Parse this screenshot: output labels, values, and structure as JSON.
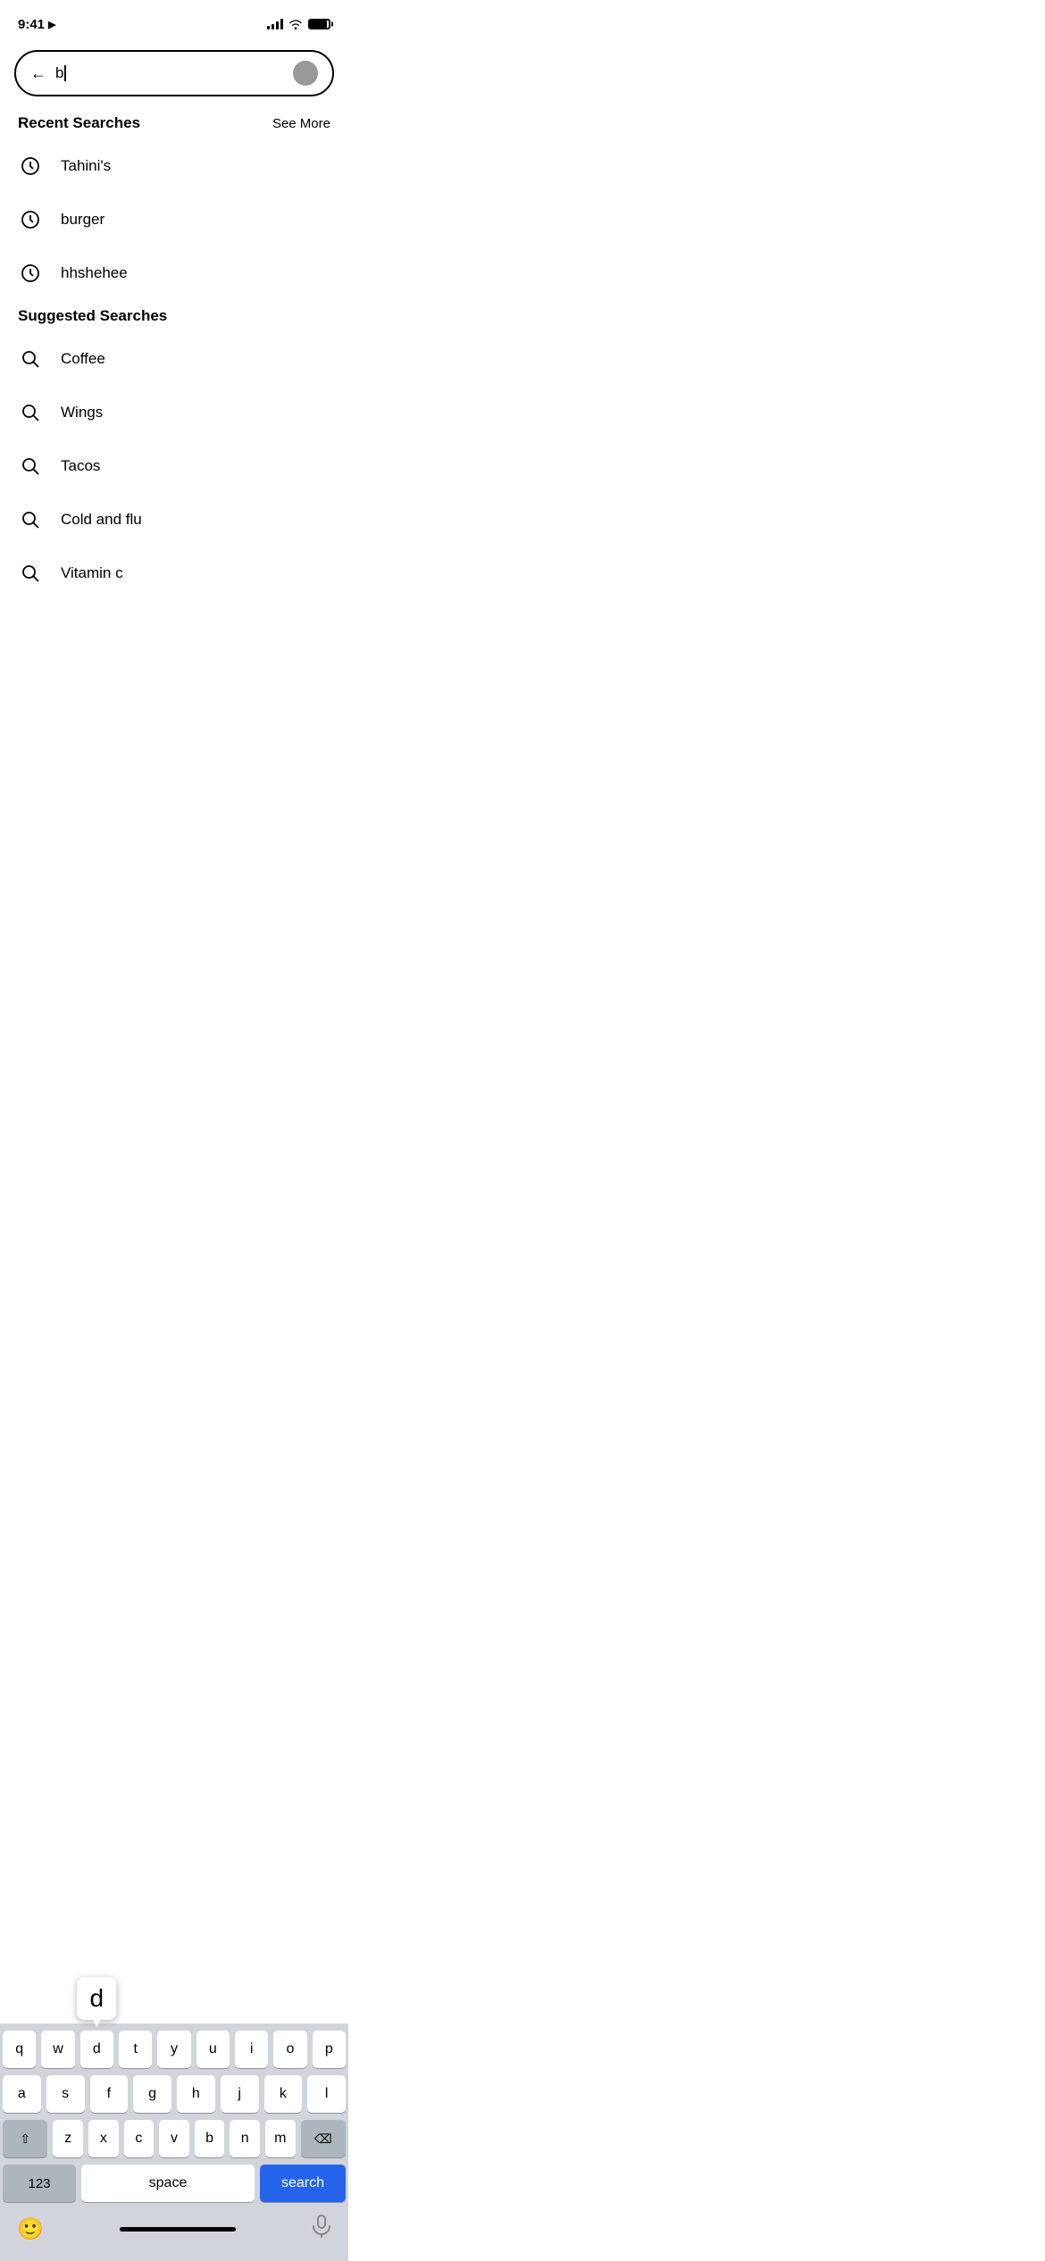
{
  "status_bar": {
    "time": "9:41",
    "location_icon": "▶",
    "signal_label": "signal",
    "wifi_label": "wifi",
    "battery_label": "battery"
  },
  "search_bar": {
    "input_value": "b",
    "back_label": "←"
  },
  "recent_searches": {
    "title": "Recent Searches",
    "see_more": "See More",
    "items": [
      {
        "label": "Tahini's"
      },
      {
        "label": "burger"
      },
      {
        "label": "hhshehee"
      }
    ]
  },
  "suggested_searches": {
    "title": "Suggested Searches",
    "items": [
      {
        "label": "Coffee"
      },
      {
        "label": "Wings"
      },
      {
        "label": "Tacos"
      },
      {
        "label": "Cold and flu"
      },
      {
        "label": "Vitamin c"
      }
    ]
  },
  "keyboard": {
    "rows": [
      [
        "q",
        "w",
        "d",
        "t",
        "y",
        "u",
        "i",
        "o",
        "p"
      ],
      [
        "a",
        "s",
        "",
        "f",
        "g",
        "h",
        "j",
        "k",
        "l"
      ],
      [
        "z",
        "x",
        "c",
        "v",
        "b",
        "n",
        "m"
      ]
    ],
    "key_123": "123",
    "space_label": "space",
    "search_label": "search",
    "highlighted_key": "d"
  }
}
